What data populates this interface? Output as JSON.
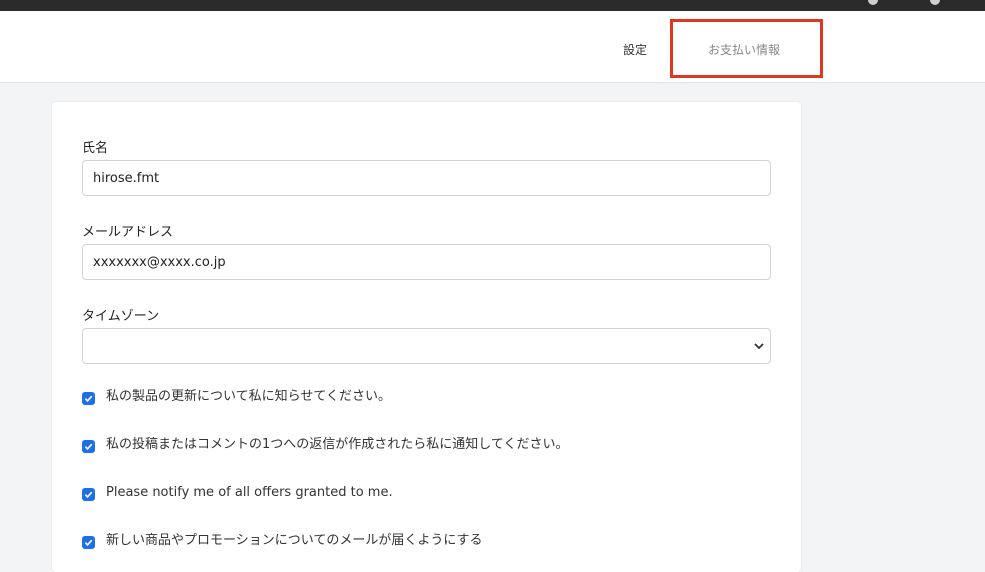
{
  "header": {
    "tabs": [
      {
        "label": "設定"
      },
      {
        "label": "お支払い情報"
      }
    ]
  },
  "form": {
    "name_label": "氏名",
    "name_value": "hirose.fmt",
    "email_label": "メールアドレス",
    "email_value": "xxxxxxx@xxxx.co.jp",
    "timezone_label": "タイムゾーン",
    "timezone_value": "",
    "checkboxes": [
      {
        "label": "私の製品の更新について私に知らせてください。",
        "checked": true
      },
      {
        "label": "私の投稿またはコメントの1つへの返信が作成されたら私に通知してください。",
        "checked": true
      },
      {
        "label": "Please notify me of all offers granted to me.",
        "checked": true
      },
      {
        "label": "新しい商品やプロモーションについてのメールが届くようにする",
        "checked": true
      }
    ]
  },
  "colors": {
    "highlight": "#e0371f",
    "checkbox": "#1f6feb"
  }
}
